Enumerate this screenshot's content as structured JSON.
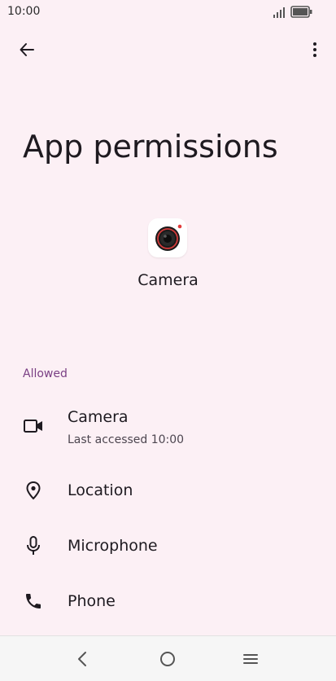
{
  "status_bar": {
    "time": "10:00"
  },
  "header": {
    "back_icon": "arrow-left-icon",
    "more_icon": "more-vert-icon"
  },
  "page": {
    "title": "App permissions",
    "app_name": "Camera",
    "app_icon": "camera-app-icon"
  },
  "section": {
    "label": "Allowed"
  },
  "permissions": [
    {
      "title": "Camera",
      "subtitle": "Last accessed 10:00",
      "icon": "videocam-icon"
    },
    {
      "title": "Location",
      "icon": "location-pin-icon"
    },
    {
      "title": "Microphone",
      "icon": "microphone-icon"
    },
    {
      "title": "Phone",
      "icon": "phone-icon"
    }
  ],
  "nav_bar": {
    "back_icon": "nav-back-icon",
    "home_icon": "nav-home-icon",
    "recents_icon": "nav-menu-icon"
  },
  "colors": {
    "background": "#fcf0f5",
    "accent": "#7a3f84",
    "text_primary": "#1e1a20",
    "text_secondary": "#4d4650",
    "nav_background": "#f6f6f6"
  }
}
